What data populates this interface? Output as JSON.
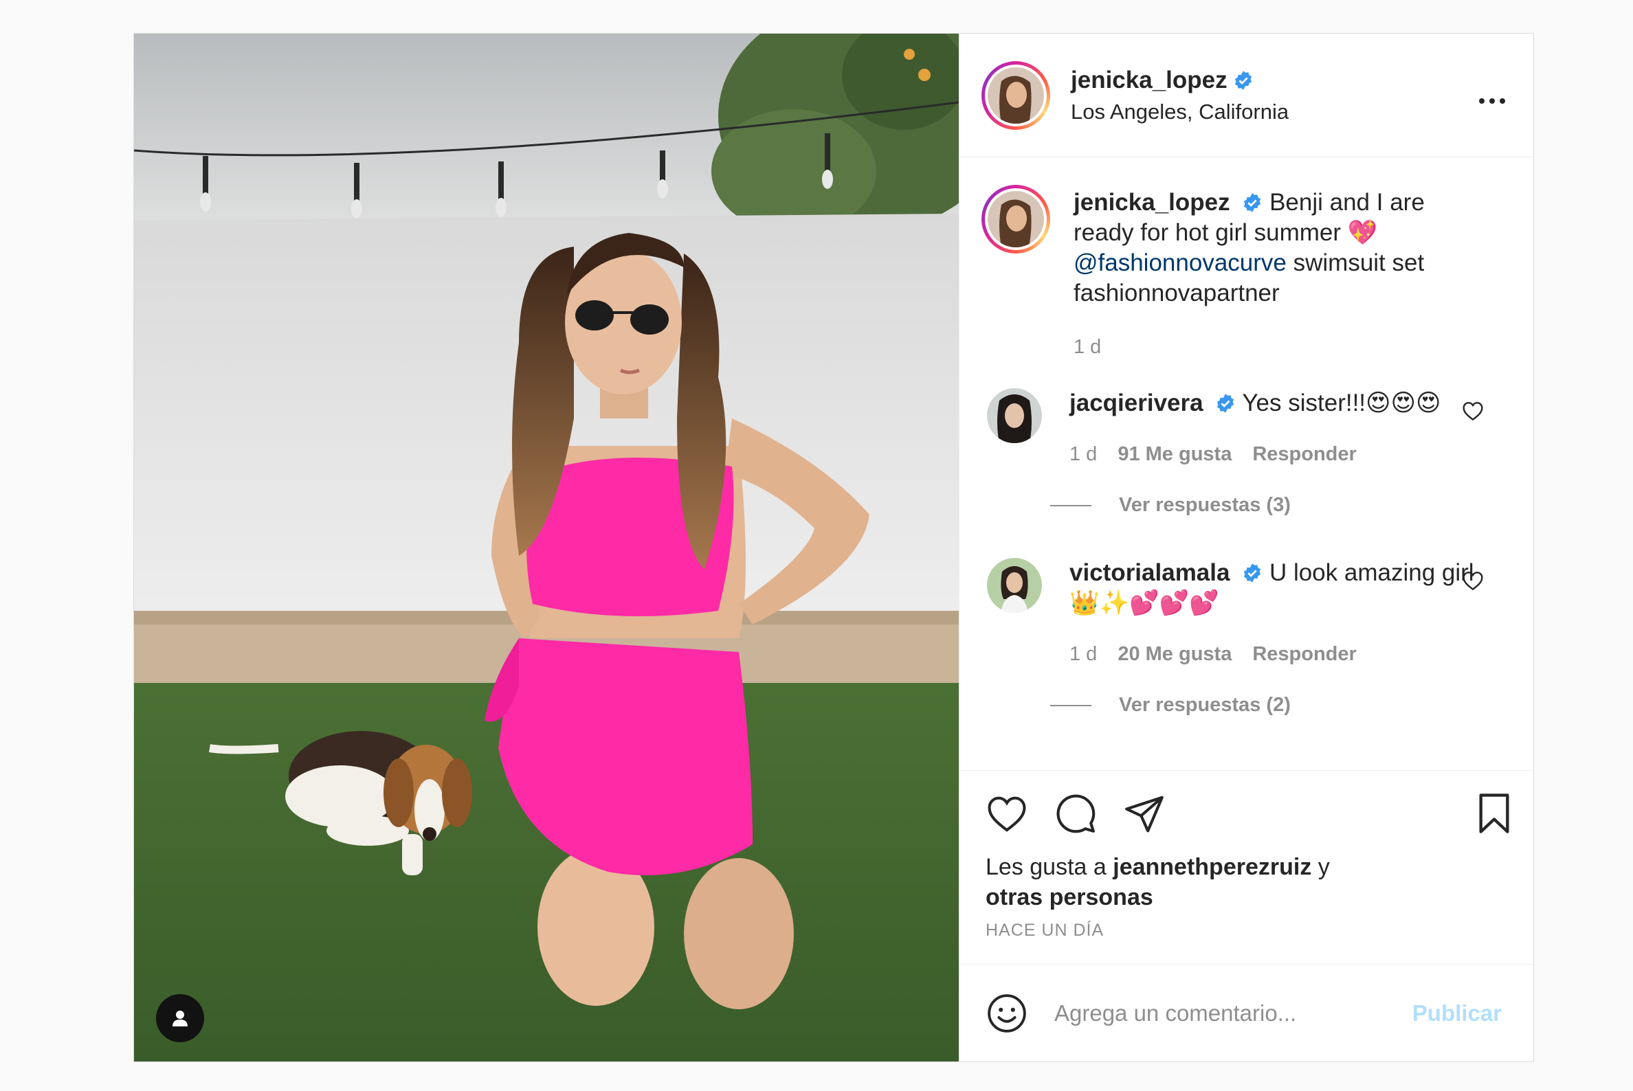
{
  "header": {
    "username": "jenicka_lopez",
    "location": "Los Angeles, California"
  },
  "caption": {
    "username": "jenicka_lopez",
    "text_1": "Benji and I are ready for hot girl summer 💖",
    "mention": "@fashionnovacurve",
    "text_2": "swimsuit set fashionnovapartner",
    "time": "1 d"
  },
  "comments": [
    {
      "username": "jacqierivera",
      "text": "Yes sister!!!😍😍😍",
      "time": "1 d",
      "likes": "91 Me gusta",
      "reply": "Responder",
      "view_replies": "Ver respuestas (3)"
    },
    {
      "username": "victorialamala",
      "text": "U look amazing girl 👑✨💕💕💕",
      "time": "1 d",
      "likes": "20 Me gusta",
      "reply": "Responder",
      "view_replies": "Ver respuestas (2)"
    }
  ],
  "likes": {
    "prefix": "Les gusta a",
    "user": "jeannethperezruiz",
    "suffix": "y",
    "others": "otras personas"
  },
  "timestamp": "HACE UN DÍA",
  "add_comment": {
    "placeholder": "Agrega un comentario...",
    "publish": "Publicar"
  },
  "icons": {
    "verified": "verified-badge-icon",
    "more": "more-options-icon",
    "like": "heart-icon",
    "comment": "comment-icon",
    "share": "paper-plane-icon",
    "save": "bookmark-icon",
    "emoji": "smiley-icon",
    "tag": "user-tag-icon"
  },
  "colors": {
    "verified": "#3897f0",
    "link": "#00376b",
    "publish_disabled": "#b2dffc",
    "secondary_text": "#8e8e8e"
  }
}
